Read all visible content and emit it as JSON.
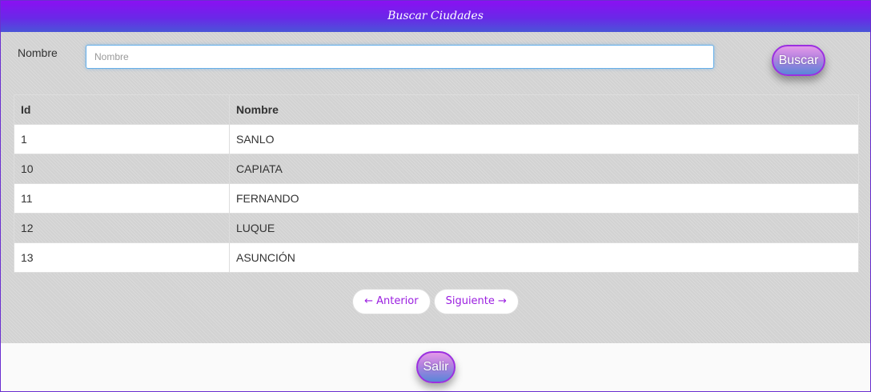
{
  "window": {
    "title": "Buscar Ciudades"
  },
  "search": {
    "label": "Nombre",
    "placeholder": "Nombre",
    "value": "",
    "button_label": "Buscar"
  },
  "table": {
    "headers": [
      "Id",
      "Nombre"
    ],
    "rows": [
      {
        "id": "1",
        "nombre": "SANLO"
      },
      {
        "id": "10",
        "nombre": "CAPIATA"
      },
      {
        "id": "11",
        "nombre": "FERNANDO"
      },
      {
        "id": "12",
        "nombre": "LUQUE"
      },
      {
        "id": "13",
        "nombre": "ASUNCIÓN"
      }
    ]
  },
  "pagination": {
    "prev_label": "← Anterior",
    "next_label": "Siguiente →"
  },
  "footer": {
    "exit_label": "Salir"
  },
  "colors": {
    "title_gradient_top": "#8a10f2",
    "title_gradient_bottom": "#4a55d8",
    "pager_text": "#9b1fe0",
    "button_border": "#9b30e0"
  }
}
